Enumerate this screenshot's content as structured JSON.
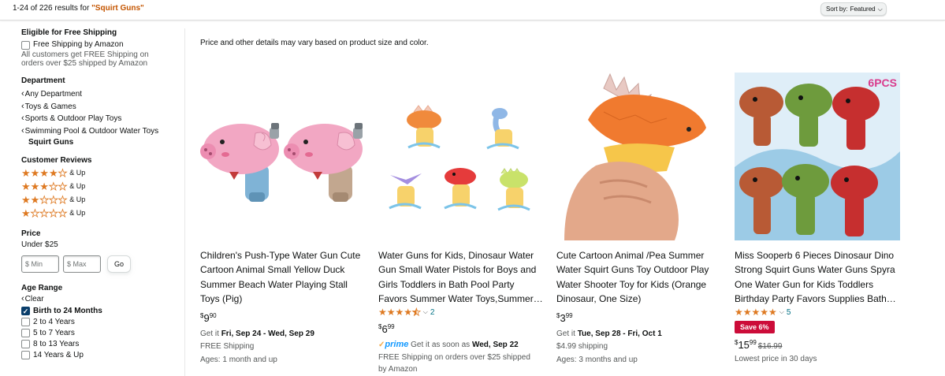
{
  "topbar": {
    "results_prefix": "1-24 of 226 results for ",
    "query": "\"Squirt Guns\"",
    "sort_label": "Sort by:",
    "sort_value": "Featured"
  },
  "sidebar": {
    "shipping": {
      "title": "Eligible for Free Shipping",
      "checkbox_label": "Free Shipping by Amazon",
      "note1": "All customers get FREE Shipping on",
      "note2": "orders over $25 shipped by Amazon"
    },
    "department": {
      "title": "Department",
      "items": [
        "Any Department",
        "Toys & Games",
        "Sports & Outdoor Play Toys",
        "Swimming Pool & Outdoor Water Toys"
      ],
      "selected": "Squirt Guns"
    },
    "reviews": {
      "title": "Customer Reviews",
      "up_label": "& Up",
      "levels": [
        4,
        3,
        2,
        1
      ]
    },
    "price": {
      "title": "Price",
      "under": "Under $25",
      "min_placeholder": "$ Min",
      "max_placeholder": "$ Max",
      "go": "Go"
    },
    "age": {
      "title": "Age Range",
      "clear": "Clear",
      "options": [
        {
          "label": "Birth to 24 Months",
          "checked": true
        },
        {
          "label": "2 to 4 Years",
          "checked": false
        },
        {
          "label": "5 to 7 Years",
          "checked": false
        },
        {
          "label": "8 to 13 Years",
          "checked": false
        },
        {
          "label": "14 Years & Up",
          "checked": false
        }
      ]
    }
  },
  "main": {
    "note": "Price and other details may vary based on product size and color.",
    "products": [
      {
        "title": "Children's Push-Type Water Gun Cute Cartoon Animal Small Yellow Duck Summer Beach Water Playing Stall Toys (Pig)",
        "price_whole": "9",
        "price_frac": "90",
        "get_it": "Get it ",
        "dates": "Fri, Sep 24 - Wed, Sep 29",
        "shipping": "FREE Shipping",
        "ages": "Ages: 1 month and up"
      },
      {
        "title": "Water Guns for Kids, Dinosaur Water Gun Small Water Pistols for Boys and Girls Toddlers in Bath Pool Party Favors Summer Water Toys,Summer…",
        "rating": 4.5,
        "rating_count": "2",
        "price_whole": "6",
        "price_frac": "99",
        "prime_text": "Get it as soon as ",
        "prime_date": "Wed, Sep 22",
        "shipping1": "FREE Shipping on orders over $25 shipped",
        "shipping2": "by Amazon"
      },
      {
        "title": "Cute Cartoon Animal /Pea Summer Water Squirt Guns Toy Outdoor Play Water Shooter Toy for Kids (Orange Dinosaur, One Size)",
        "price_whole": "3",
        "price_frac": "99",
        "get_it": "Get it ",
        "dates": "Tue, Sep 28 - Fri, Oct 1",
        "shipping": "$4.99 shipping",
        "ages": "Ages: 3 months and up"
      },
      {
        "title": "Miss Sooperb 6 Pieces Dinosaur Dino Strong Squirt Guns Water Guns Spyra One Water Gun for Kids Toddlers Birthday Party Favors Supplies Bath…",
        "rating": 5,
        "rating_count": "5",
        "badge": "Save 6%",
        "price_whole": "15",
        "price_frac": "99",
        "list_price": "$16.99",
        "lowest": "Lowest price in 30 days",
        "img_label": "6PCS"
      }
    ],
    "prime_label": "prime"
  },
  "colors": {
    "accent_orange": "#c45500",
    "star": "#de7921",
    "link": "#007185",
    "badge_red": "#cc0c39",
    "prime_blue": "#1399ff"
  }
}
